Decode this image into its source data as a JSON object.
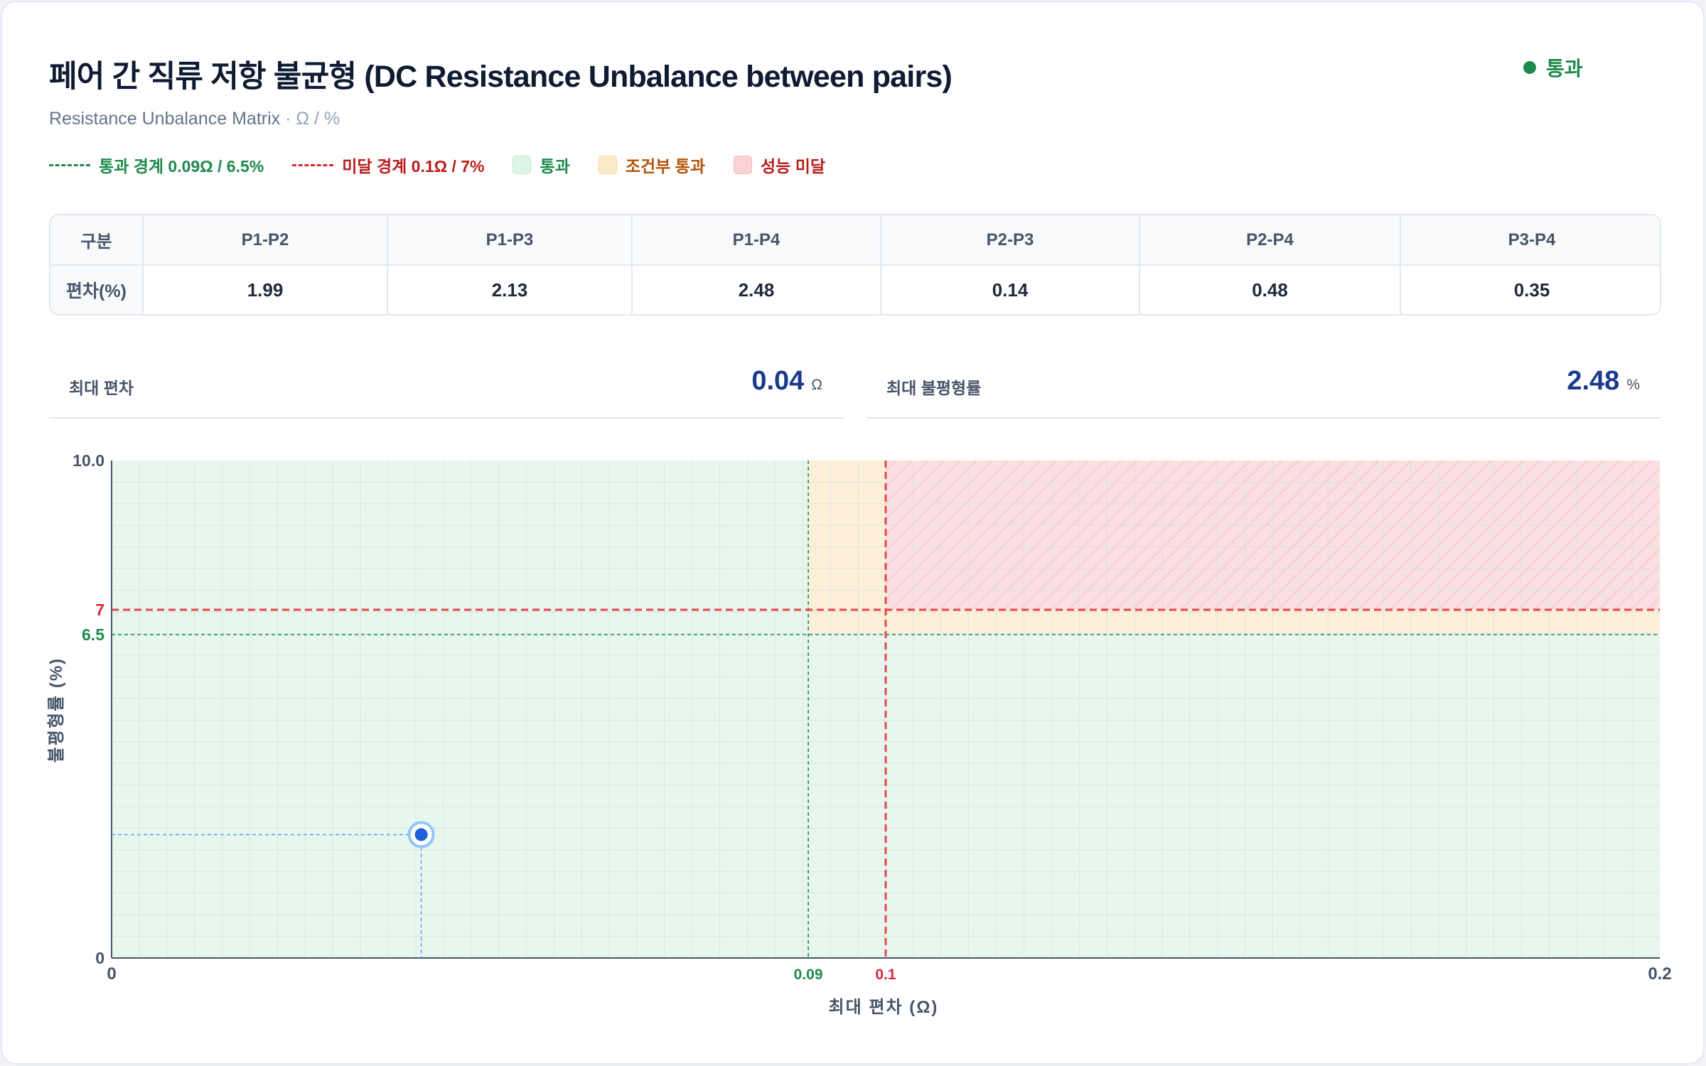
{
  "header": {
    "title": "페어 간 직류 저항 불균형 (DC Resistance Unbalance between pairs)",
    "subtitle_main": "Resistance Unbalance Matrix",
    "subtitle_units": " · Ω / %",
    "status_label": "통과",
    "status_color": "#1e8a4c"
  },
  "legend": {
    "pass_line": "통과 경계 0.09Ω / 6.5%",
    "fail_line": "미달 경계 0.1Ω / 7%",
    "pass_zone": "통과",
    "conditional_zone": "조건부 통과",
    "fail_zone": "성능 미달",
    "colors": {
      "pass": "#1e8a4c",
      "fail": "#d62839",
      "conditional": "#b45309"
    }
  },
  "matrix": {
    "row_header": "구분",
    "pairs": [
      "P1-P2",
      "P1-P3",
      "P1-P4",
      "P2-P3",
      "P2-P4",
      "P3-P4"
    ],
    "row_label": "편차(%)",
    "values": [
      "1.99",
      "2.13",
      "2.48",
      "0.14",
      "0.48",
      "0.35"
    ]
  },
  "metrics": {
    "max_dev_label": "최대 편차",
    "max_dev_value": "0.04",
    "max_dev_unit": "Ω",
    "max_unb_label": "최대 불평형률",
    "max_unb_value": "2.48",
    "max_unb_unit": "%"
  },
  "chart_data": {
    "type": "scatter",
    "xlabel": "최대 편차 (Ω)",
    "ylabel": "불평형률 (%)",
    "xlim": [
      0,
      0.2
    ],
    "ylim": [
      0,
      10
    ],
    "x_ticks": [
      "0",
      "0.09",
      "0.1",
      "0.2"
    ],
    "y_ticks": [
      "10.0",
      "7",
      "6.5",
      "0"
    ],
    "grid": true,
    "thresholds": {
      "pass_x": 0.09,
      "pass_y": 6.5,
      "fail_x": 0.1,
      "fail_y": 7
    },
    "points": [
      {
        "x": 0.04,
        "y": 2.48
      }
    ]
  }
}
